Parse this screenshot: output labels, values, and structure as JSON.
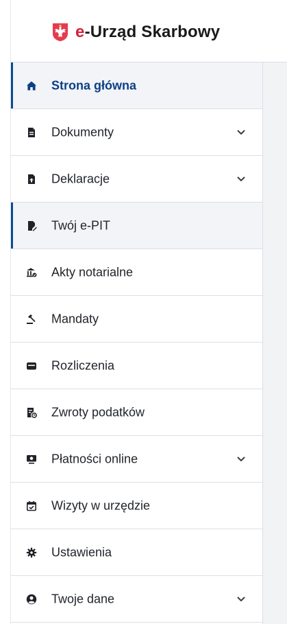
{
  "header": {
    "logo_prefix": "e",
    "logo_rest": "-Urząd Skarbowy",
    "brand_color": "#d4213d"
  },
  "sidebar": {
    "accent_color": "#0c4b95",
    "items": [
      {
        "label": "Strona główna",
        "icon": "home-icon",
        "state": "active"
      },
      {
        "label": "Dokumenty",
        "icon": "document-icon",
        "expandable": true
      },
      {
        "label": "Deklaracje",
        "icon": "document-upload-icon",
        "expandable": true
      },
      {
        "label": "Twój e-PIT",
        "icon": "document-edit-icon",
        "state": "marked"
      },
      {
        "label": "Akty notarialne",
        "icon": "notary-building-icon"
      },
      {
        "label": "Mandaty",
        "icon": "gavel-icon"
      },
      {
        "label": "Rozliczenia",
        "icon": "wallet-icon"
      },
      {
        "label": "Zwroty podatków",
        "icon": "tax-refund-icon"
      },
      {
        "label": "Płatności online",
        "icon": "online-payment-icon",
        "expandable": true
      },
      {
        "label": "Wizyty w urzędzie",
        "icon": "calendar-check-icon"
      },
      {
        "label": "Ustawienia",
        "icon": "gear-icon"
      },
      {
        "label": "Twoje dane",
        "icon": "user-circle-icon",
        "expandable": true
      }
    ]
  }
}
